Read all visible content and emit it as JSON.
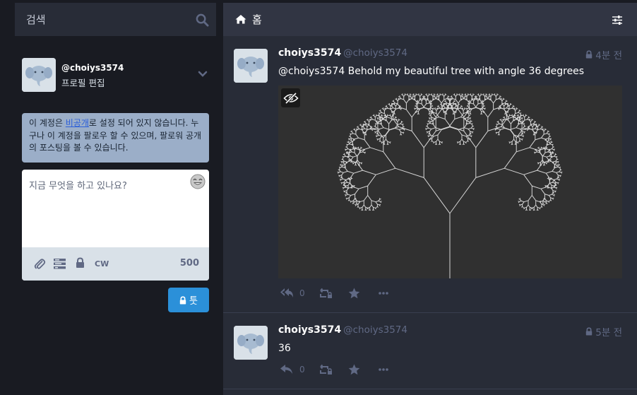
{
  "search": {
    "placeholder": "검색"
  },
  "profile": {
    "handle": "@choiys3574",
    "edit_label": "프로필 편집"
  },
  "notice": {
    "text_before": "이 계정은 ",
    "link": "비공개",
    "text_after": "로 설정 되어 있지 않습니다. 누구나 이 계정을 팔로우 할 수 있으며, 팔로워 공개의 포스팅을 볼 수 있습니다."
  },
  "compose": {
    "placeholder": "지금 무엇을 하고 있나요?",
    "cw_label": "CW",
    "char_count": "500",
    "toot_label": "툿"
  },
  "column": {
    "title": "홈"
  },
  "statuses": [
    {
      "display_name": "choiys3574",
      "acct": "@choiys3574",
      "time": "4분 전",
      "mention": "@choiys3574",
      "content": " Behold my beautiful tree with angle 36 degrees",
      "reply_count": "0",
      "tree_angle_degrees": 36
    },
    {
      "display_name": "choiys3574",
      "acct": "@choiys3574",
      "time": "5분 전",
      "content": "36",
      "reply_count": "0"
    }
  ],
  "colors": {
    "accent": "#2b90d9",
    "background": "#191b22",
    "column": "#282c37",
    "header": "#313543",
    "muted": "#606984",
    "notice": "#9baec8"
  }
}
